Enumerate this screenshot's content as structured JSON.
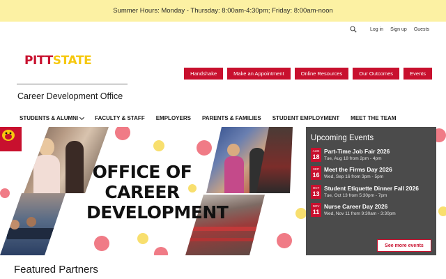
{
  "alert": {
    "text": "Summer Hours:  Monday - Thursday: 8:00am-4:30pm; Friday: 8:00am-noon"
  },
  "utility": {
    "links": [
      "Log in",
      "Sign up",
      "Guests"
    ],
    "search_icon": "search-icon"
  },
  "logo": {
    "part1": "PITT",
    "part2": "STATE"
  },
  "quicklinks": [
    "Handshake",
    "Make an Appointment",
    "Online Resources",
    "Our Outcomes",
    "Events"
  ],
  "site_title": "Career Development Office",
  "nav": [
    "STUDENTS & ALUMNI",
    "FACULTY & STAFF",
    "EMPLOYERS",
    "PARENTS & FAMILIES",
    "STUDENT EMPLOYMENT",
    "MEET THE TEAM"
  ],
  "hero": {
    "headline": [
      "OFFICE OF",
      "CAREER",
      "DEVELOPMENT"
    ]
  },
  "events": {
    "heading": "Upcoming Events",
    "items": [
      {
        "month": "AUG",
        "day": "18",
        "title": "Part-Time Job Fair 2026",
        "when": "Tue, Aug 18 from 2pm - 4pm"
      },
      {
        "month": "SEP",
        "day": "16",
        "title": "Meet the Firms Day 2026",
        "when": "Wed, Sep 16 from 3pm - 5pm"
      },
      {
        "month": "OCT",
        "day": "13",
        "title": "Student Etiquette Dinner Fall 2026",
        "when": "Tue, Oct 13 from 5:30pm - 7pm"
      },
      {
        "month": "NOV",
        "day": "11",
        "title": "Nurse Career Day 2026",
        "when": "Wed, Nov 11 from 9:30am - 3:30pm"
      }
    ],
    "see_more": "See more events"
  },
  "featured": "Featured Partners",
  "colors": {
    "brand_red": "#c8102e",
    "brand_gold": "#f6c80f",
    "alert_bg": "#fcf1a3",
    "events_bg": "#4b4b4b"
  }
}
